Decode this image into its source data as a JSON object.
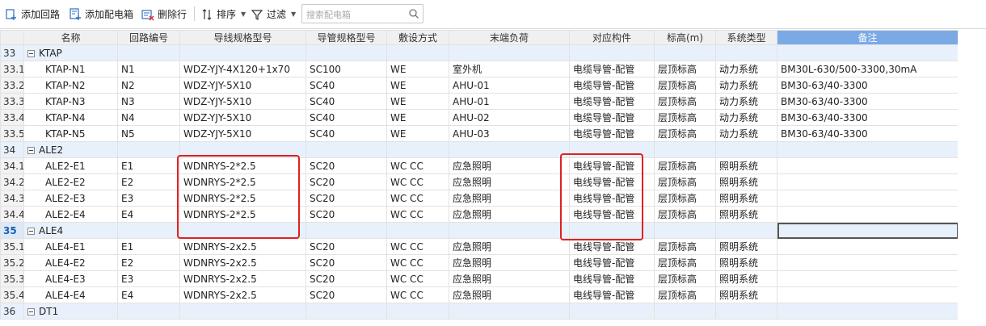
{
  "toolbar": {
    "add_circuit": "添加回路",
    "add_box": "添加配电箱",
    "delete_row": "删除行",
    "sort": "排序",
    "filter": "过滤",
    "search_placeholder": "搜索配电箱"
  },
  "columns": [
    "名称",
    "回路编号",
    "导线规格型号",
    "导管规格型号",
    "敷设方式",
    "末端负荷",
    "对应构件",
    "标高(m)",
    "系统类型",
    "备注"
  ],
  "rows": [
    {
      "num": "33",
      "group": true,
      "name": "KTAP"
    },
    {
      "num": "33.1",
      "name": "KTAP-N1",
      "cells": [
        "N1",
        "WDZ-YJY-4X120+1x70",
        "SC100",
        "WE",
        "室外机",
        "电缆导管-配管",
        "层顶标高",
        "动力系统",
        "BM30L-630/500-3300,30mA"
      ]
    },
    {
      "num": "33.2",
      "name": "KTAP-N2",
      "cells": [
        "N2",
        "WDZ-YJY-5X10",
        "SC40",
        "WE",
        "AHU-01",
        "电缆导管-配管",
        "层顶标高",
        "动力系统",
        "BM30-63/40-3300"
      ]
    },
    {
      "num": "33.3",
      "name": "KTAP-N3",
      "cells": [
        "N3",
        "WDZ-YJY-5X10",
        "SC40",
        "WE",
        "AHU-01",
        "电缆导管-配管",
        "层顶标高",
        "动力系统",
        "BM30-63/40-3300"
      ]
    },
    {
      "num": "33.4",
      "name": "KTAP-N4",
      "cells": [
        "N4",
        "WDZ-YJY-5X10",
        "SC40",
        "WE",
        "AHU-02",
        "电缆导管-配管",
        "层顶标高",
        "动力系统",
        "BM30-63/40-3300"
      ]
    },
    {
      "num": "33.5",
      "name": "KTAP-N5",
      "cells": [
        "N5",
        "WDZ-YJY-5X10",
        "SC40",
        "WE",
        "AHU-03",
        "电缆导管-配管",
        "层顶标高",
        "动力系统",
        "BM30-63/40-3300"
      ]
    },
    {
      "num": "34",
      "group": true,
      "name": "ALE2"
    },
    {
      "num": "34.1",
      "name": "ALE2-E1",
      "cells": [
        "E1",
        "WDNRYS-2*2.5",
        "SC20",
        "WC CC",
        "应急照明",
        "电线导管-配管",
        "层顶标高",
        "照明系统",
        ""
      ]
    },
    {
      "num": "34.2",
      "name": "ALE2-E2",
      "cells": [
        "E2",
        "WDNRYS-2*2.5",
        "SC20",
        "WC CC",
        "应急照明",
        "电线导管-配管",
        "层顶标高",
        "照明系统",
        ""
      ]
    },
    {
      "num": "34.3",
      "name": "ALE2-E3",
      "cells": [
        "E3",
        "WDNRYS-2*2.5",
        "SC20",
        "WC CC",
        "应急照明",
        "电线导管-配管",
        "层顶标高",
        "照明系统",
        ""
      ]
    },
    {
      "num": "34.4",
      "name": "ALE2-E4",
      "cells": [
        "E4",
        "WDNRYS-2*2.5",
        "SC20",
        "WC CC",
        "应急照明",
        "电线导管-配管",
        "层顶标高",
        "照明系统",
        ""
      ]
    },
    {
      "num": "35",
      "group": true,
      "active": true,
      "name": "ALE4"
    },
    {
      "num": "35.1",
      "name": "ALE4-E1",
      "cells": [
        "E1",
        "WDNRYS-2x2.5",
        "SC20",
        "WC CC",
        "应急照明",
        "电线导管-配管",
        "层顶标高",
        "照明系统",
        ""
      ]
    },
    {
      "num": "35.2",
      "name": "ALE4-E2",
      "cells": [
        "E2",
        "WDNRYS-2x2.5",
        "SC20",
        "WC CC",
        "应急照明",
        "电线导管-配管",
        "层顶标高",
        "照明系统",
        ""
      ]
    },
    {
      "num": "35.3",
      "name": "ALE4-E3",
      "cells": [
        "E3",
        "WDNRYS-2x2.5",
        "SC20",
        "WC CC",
        "应急照明",
        "电线导管-配管",
        "层顶标高",
        "照明系统",
        ""
      ]
    },
    {
      "num": "35.4",
      "name": "ALE4-E4",
      "cells": [
        "E4",
        "WDNRYS-2x2.5",
        "SC20",
        "WC CC",
        "应急照明",
        "电线导管-配管",
        "层顶标高",
        "照明系统",
        ""
      ]
    },
    {
      "num": "36",
      "group": true,
      "name": "DT1"
    }
  ],
  "colors": {
    "header_highlight": "#7aa9e6",
    "group_row": "#e8f1fb",
    "annotation_red": "#e02020",
    "icon_blue": "#2f6fc4"
  }
}
